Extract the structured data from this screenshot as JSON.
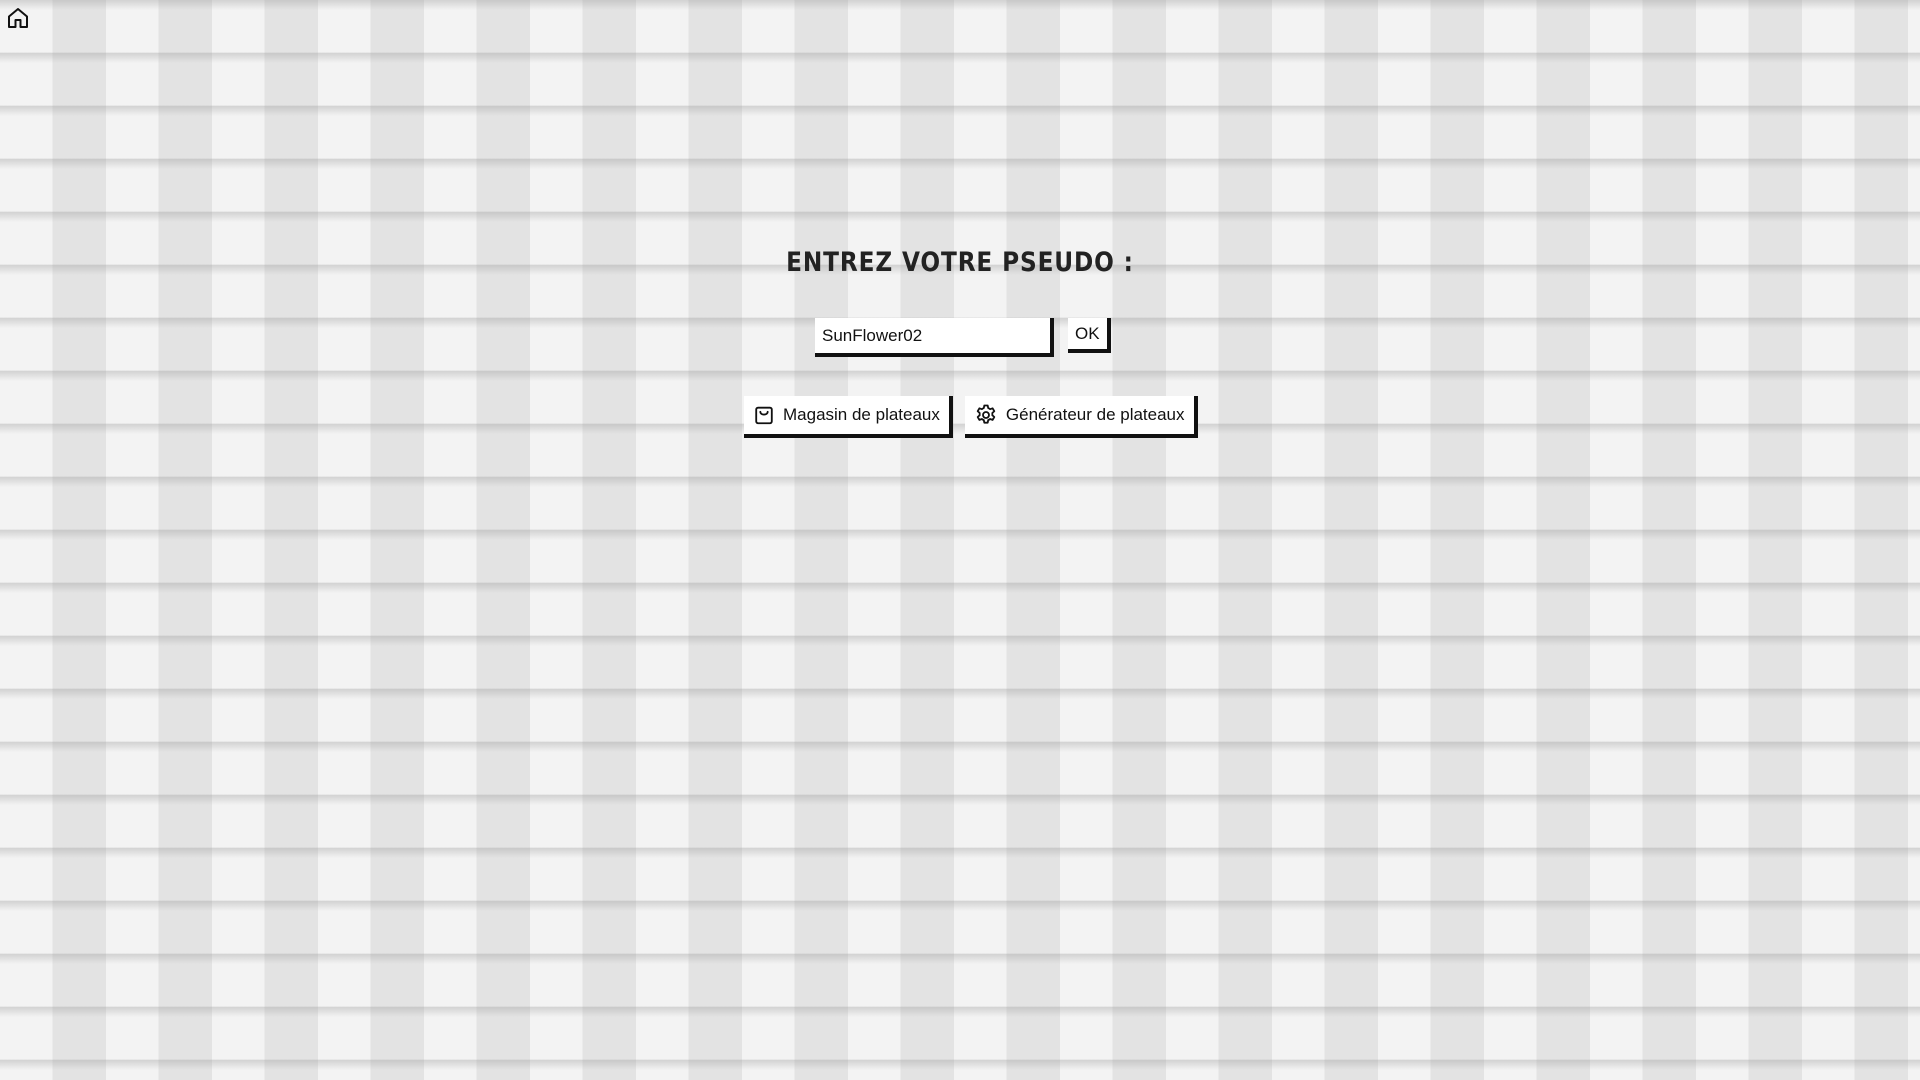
{
  "nav": {
    "home_icon": "home-icon"
  },
  "form": {
    "title": "ENTREZ VOTRE PSEUDO :",
    "pseudo_value": "SunFlower02",
    "ok_label": "OK"
  },
  "actions": {
    "shop": {
      "label": "Magasin de plateaux",
      "icon": "shopping-bag-icon"
    },
    "generator": {
      "label": "Générateur de plateaux",
      "icon": "gear-icon"
    }
  },
  "colors": {
    "background": "#eaeaea",
    "text": "#111111",
    "button_bg": "#ffffff",
    "button_shadow": "#111111"
  }
}
